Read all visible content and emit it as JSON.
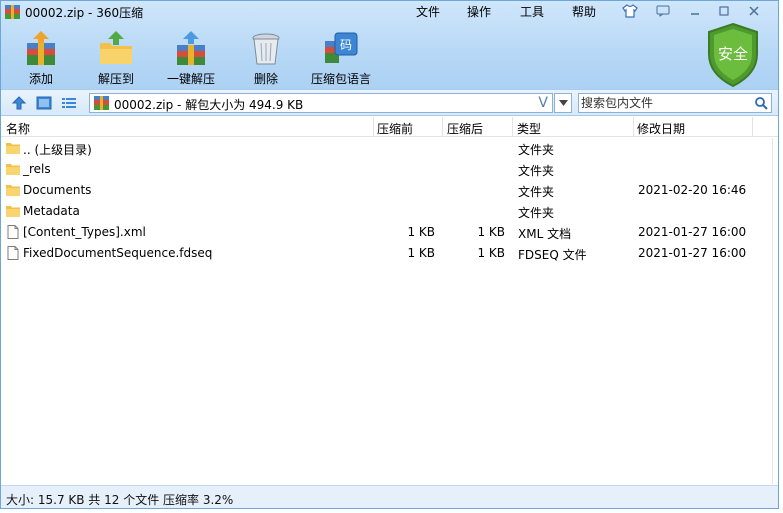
{
  "window": {
    "title": "00002.zip - 360压缩"
  },
  "menu": {
    "file": "文件",
    "operate": "操作",
    "tools": "工具",
    "help": "帮助"
  },
  "toolbar": {
    "add": "添加",
    "extract_to": "解压到",
    "one_click_extract": "一键解压",
    "delete": "删除",
    "language_pack": "压缩包语言"
  },
  "security_badge": "安全",
  "address": {
    "path": "00002.zip - 解包大小为 494.9 KB",
    "search_placeholder": "搜索包内文件"
  },
  "columns": {
    "name": "名称",
    "packed": "压缩前",
    "size": "压缩后",
    "type": "类型",
    "modified": "修改日期"
  },
  "files": [
    {
      "name": ".. (上级目录)",
      "packed": "",
      "size": "",
      "type": "文件夹",
      "modified": "",
      "icon": "folder-icon"
    },
    {
      "name": "_rels",
      "packed": "",
      "size": "",
      "type": "文件夹",
      "modified": "",
      "icon": "folder-icon"
    },
    {
      "name": "Documents",
      "packed": "",
      "size": "",
      "type": "文件夹",
      "modified": "2021-02-20 16:46",
      "icon": "folder-icon"
    },
    {
      "name": "Metadata",
      "packed": "",
      "size": "",
      "type": "文件夹",
      "modified": "",
      "icon": "folder-icon"
    },
    {
      "name": "[Content_Types].xml",
      "packed": "1 KB",
      "size": "1 KB",
      "type": "XML 文档",
      "modified": "2021-01-27 16:00",
      "icon": "file-icon"
    },
    {
      "name": "FixedDocumentSequence.fdseq",
      "packed": "1 KB",
      "size": "1 KB",
      "type": "FDSEQ 文件",
      "modified": "2021-01-27 16:00",
      "icon": "file-icon"
    }
  ],
  "status": {
    "text": "大小: 15.7 KB 共 12 个文件 压缩率 3.2%"
  },
  "colors": {
    "accent": "#b7d8f6",
    "shield": "#5aa83a",
    "folder": "#f5c242"
  }
}
